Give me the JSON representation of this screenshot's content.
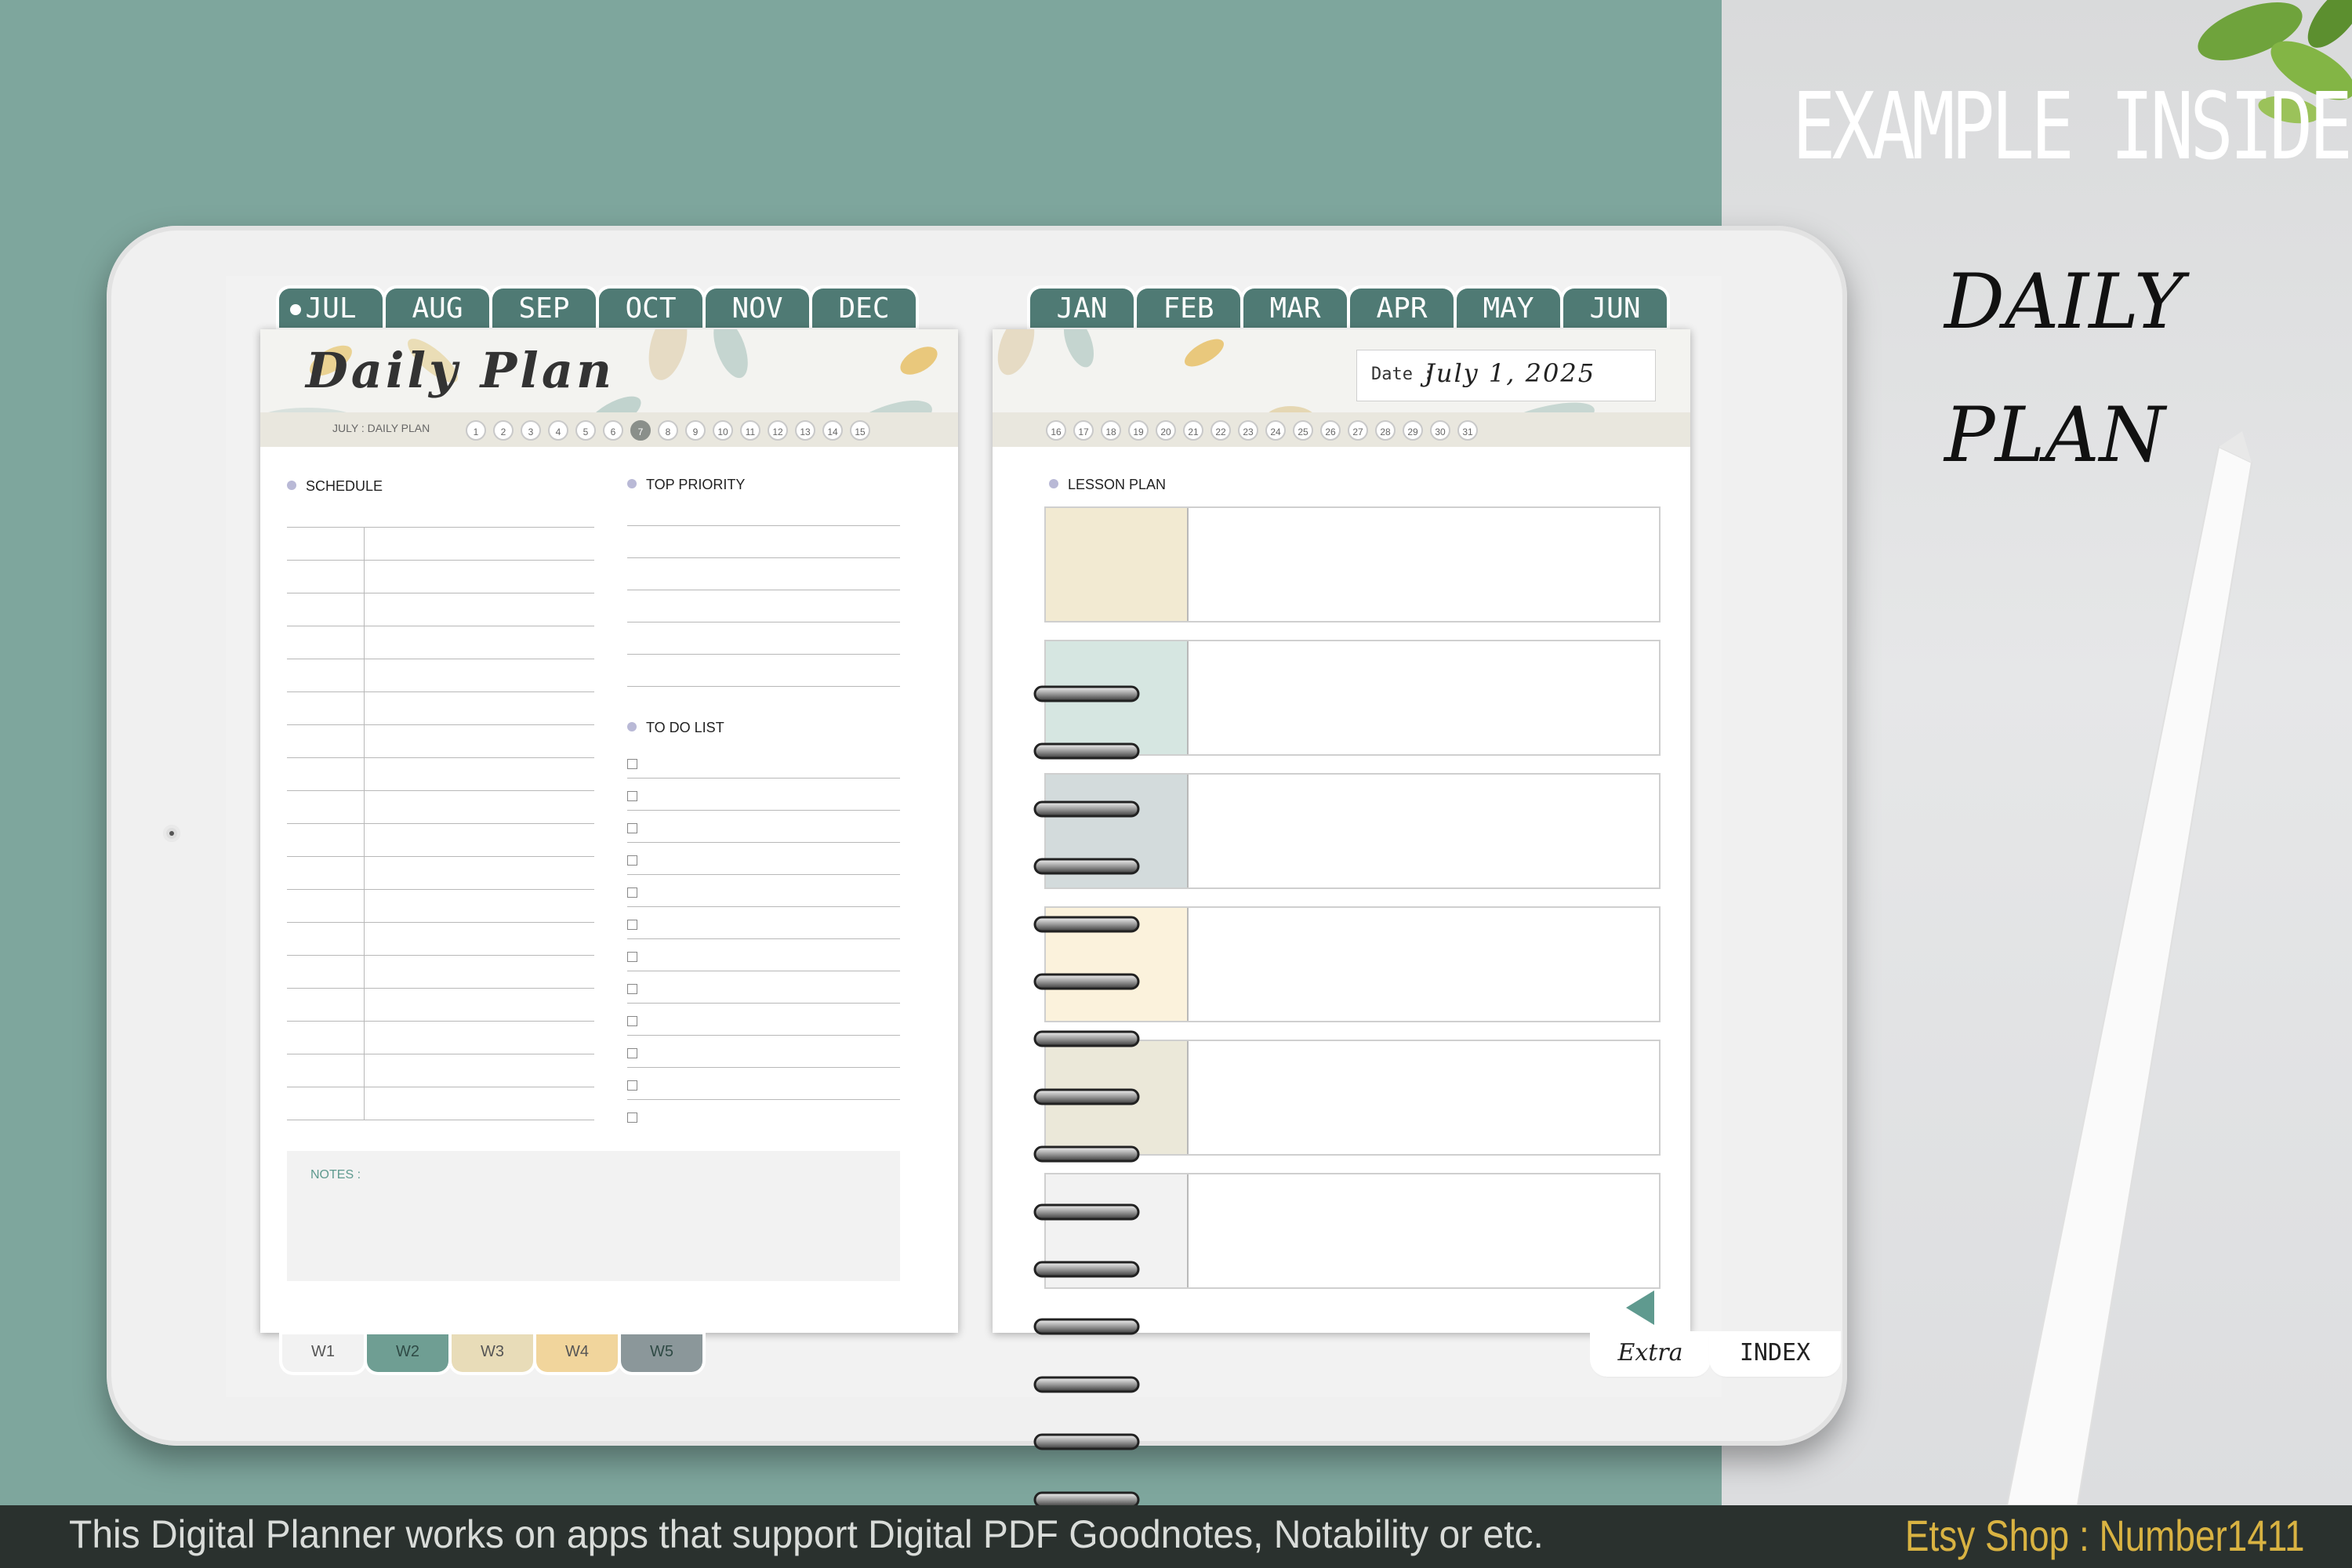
{
  "headline": "EXAMPLE INSIDE :",
  "hand_title": [
    "DAILY",
    "PLAN"
  ],
  "footer": {
    "text": "This Digital Planner works on apps that support Digital PDF Goodnotes, Notability or etc.",
    "shop": "Etsy Shop : Number1411"
  },
  "left_page": {
    "tabs": [
      "JUL",
      "AUG",
      "SEP",
      "OCT",
      "NOV",
      "DEC"
    ],
    "title": "Daily Plan",
    "mini_label": "JULY  :  DAILY PLAN",
    "days": [
      "1",
      "2",
      "3",
      "4",
      "5",
      "6",
      "7",
      "8",
      "9",
      "10",
      "11",
      "12",
      "13",
      "14",
      "15"
    ],
    "active_day": "7",
    "schedule_label": "SCHEDULE",
    "top_priority_label": "TOP PRIORITY",
    "todo_label": "TO DO LIST",
    "notes_label": "NOTES :",
    "week_tabs": [
      {
        "label": "W1",
        "color": "#f2f2f2"
      },
      {
        "label": "W2",
        "color": "#6f9e93"
      },
      {
        "label": "W3",
        "color": "#e8dcb8"
      },
      {
        "label": "W4",
        "color": "#f1d59c"
      },
      {
        "label": "W5",
        "color": "#8b979a"
      }
    ]
  },
  "right_page": {
    "tabs": [
      "JAN",
      "FEB",
      "MAR",
      "APR",
      "MAY",
      "JUN"
    ],
    "date_label": "Date :",
    "date_value": "July 1, 2025",
    "days": [
      "16",
      "17",
      "18",
      "19",
      "20",
      "21",
      "22",
      "23",
      "24",
      "25",
      "26",
      "27",
      "28",
      "29",
      "30",
      "31"
    ],
    "lesson_label": "LESSON PLAN",
    "lesson_colors": [
      "#f2ead2",
      "#d6e6e1",
      "#d3dbdc",
      "#fbf2dc",
      "#ebe8d9",
      "#f2f2f2"
    ],
    "bottom_tabs": [
      "Extra",
      "INDEX"
    ]
  },
  "colors": {
    "accent": "#4f7a74",
    "background": "#7ea69d"
  }
}
